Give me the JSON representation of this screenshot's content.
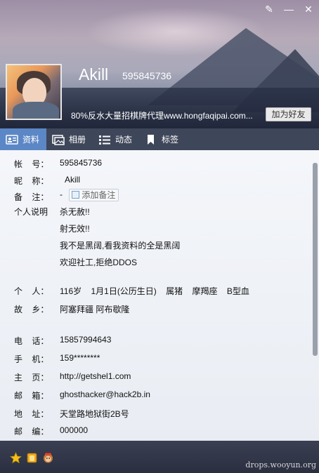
{
  "window": {
    "controls": {
      "skin": "✎",
      "minimize": "—",
      "close": "✕"
    }
  },
  "profile": {
    "nickname": "Akill",
    "qq_number": "595845736",
    "signature": "80%反水大量招棋牌代理www.hongfaqipai.com...",
    "add_friend_label": "加为好友"
  },
  "tabs": [
    {
      "label": "资料",
      "icon": "profile-card-icon",
      "active": true
    },
    {
      "label": "相册",
      "icon": "photo-album-icon",
      "active": false
    },
    {
      "label": "动态",
      "icon": "feed-list-icon",
      "active": false
    },
    {
      "label": "标签",
      "icon": "bookmark-icon",
      "active": false
    }
  ],
  "info": {
    "account": {
      "label": "帐    号：",
      "value": "595845736"
    },
    "nickname": {
      "label": "昵    称：",
      "value": "Akill"
    },
    "remark": {
      "label": "备    注：",
      "value": "-",
      "add_label": "添加备注"
    },
    "bio": {
      "label": "个人说明",
      "lines": [
        "杀无赦!!",
        "射无效!!",
        "我不是黑阔,看我资料的全是黑阔",
        "欢迎社工,拒绝DDOS"
      ]
    },
    "personal": {
      "label": "个    人：",
      "value": "116岁    1月1日(公历生日)    属猪    摩羯座    B型血"
    },
    "hometown": {
      "label": "故    乡：",
      "value": "阿塞拜疆 阿布歇隆"
    },
    "phone": {
      "label": "电    话：",
      "value": "15857994643"
    },
    "mobile": {
      "label": "手    机：",
      "value": "159********"
    },
    "homepage": {
      "label": "主    页：",
      "value": "http://getshel1.com"
    },
    "email": {
      "label": "邮    箱：",
      "value": "ghosthacker@hack2b.in"
    },
    "address": {
      "label": "地    址：",
      "value": "天堂路地狱街2B号"
    },
    "postcode": {
      "label": "邮    编：",
      "value": "000000"
    }
  },
  "footer": {
    "icons": [
      "star-icon",
      "qq-show-icon",
      "monkey-icon"
    ],
    "watermark": "drops.wooyun.org"
  },
  "colors": {
    "tab_active": "#5c87c6",
    "tab_bar": "#3e4659",
    "footer": "#2a2f40"
  }
}
